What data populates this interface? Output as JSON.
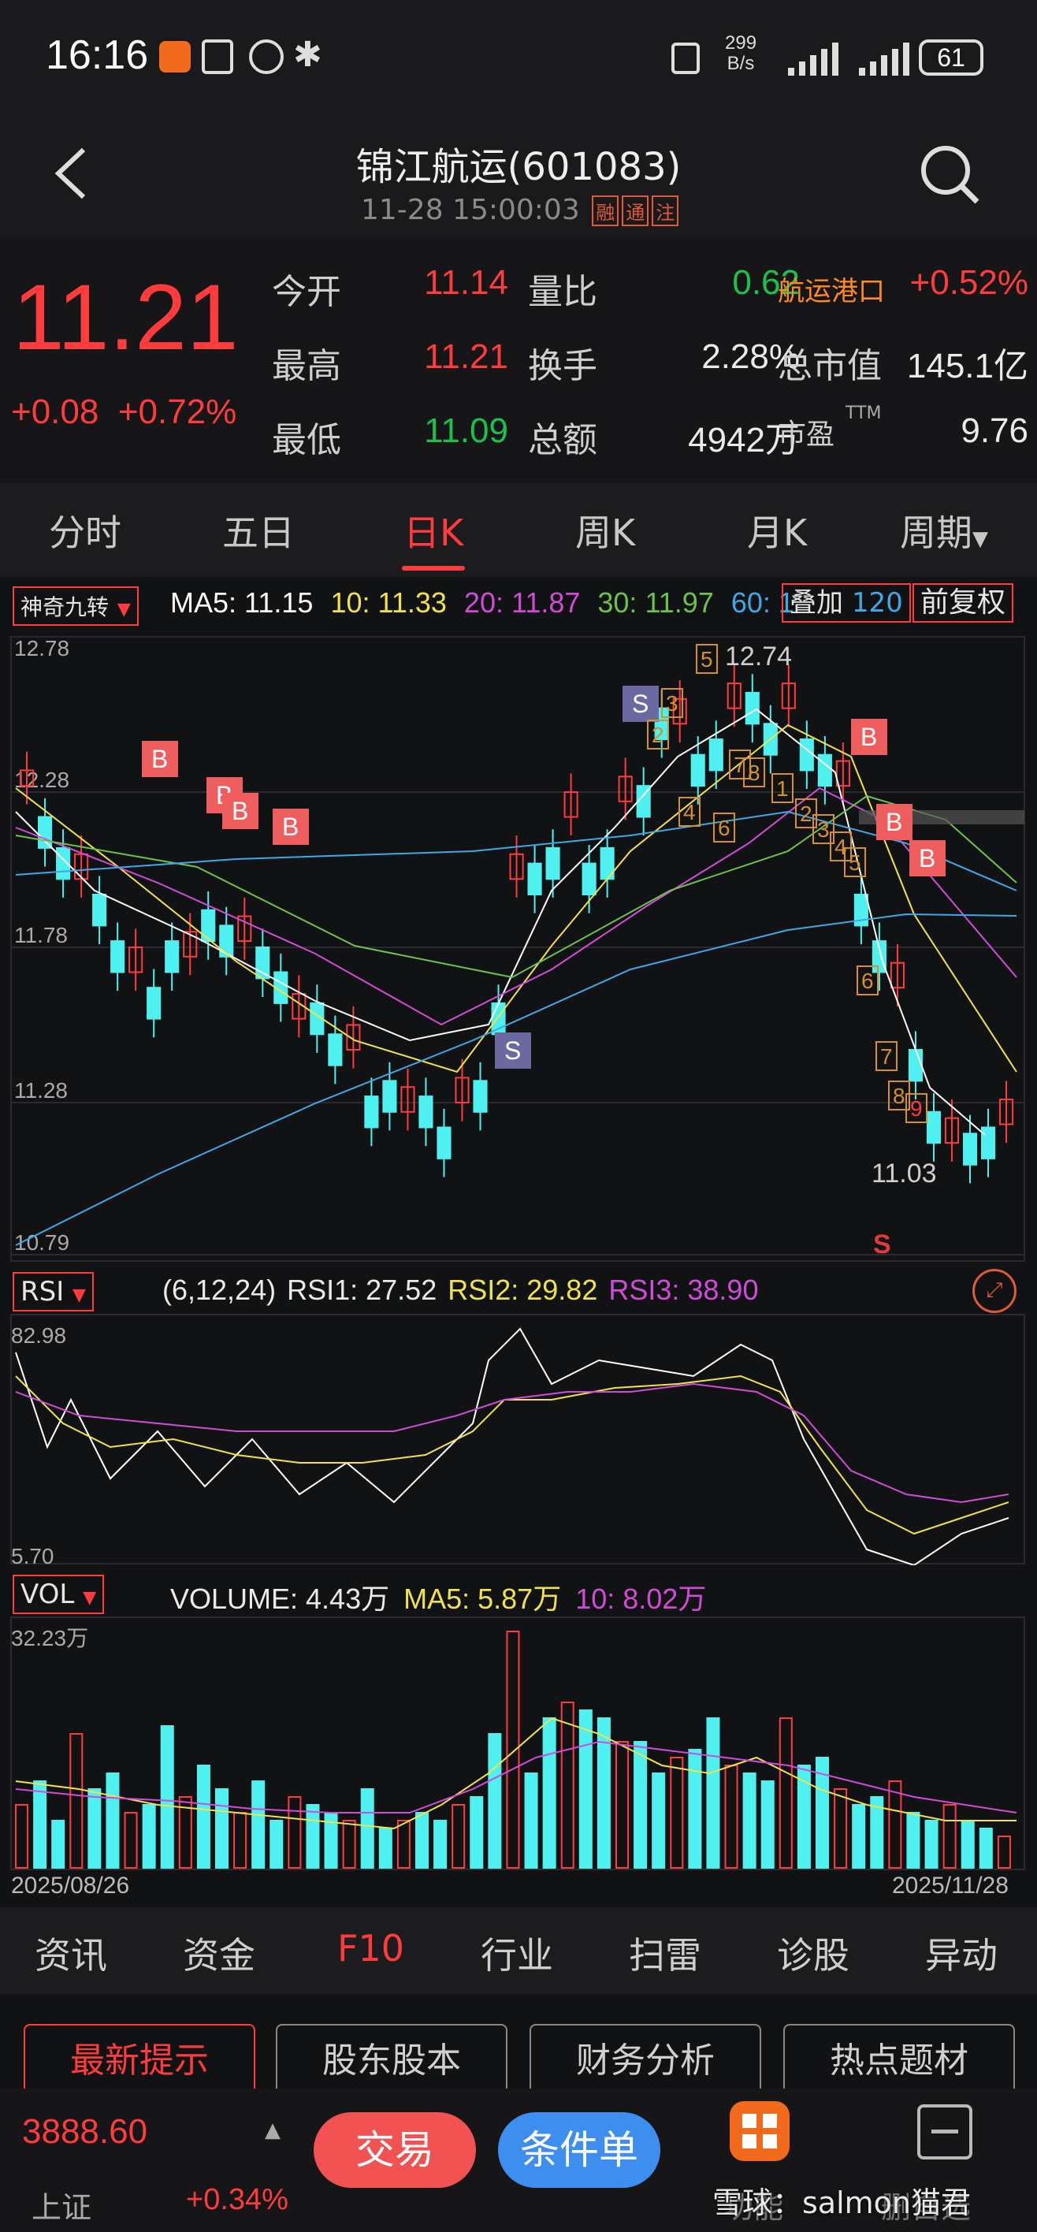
{
  "status_bar": {
    "time": "16:16",
    "net_speed_value": "299",
    "net_speed_unit": "B/s",
    "battery": "61",
    "icons": [
      "app-notification-icon",
      "nfc-icon",
      "alarm-icon",
      "bluetooth-icon",
      "vibrate-icon",
      "signal-icon",
      "signal-icon",
      "battery-icon"
    ]
  },
  "header": {
    "title": "锦江航运(601083)",
    "datetime": "11-28 15:00:03",
    "tags": [
      "融",
      "通",
      "注"
    ]
  },
  "quote": {
    "price": "11.21",
    "change_abs": "+0.08",
    "change_pct": "+0.72%",
    "rows": [
      {
        "l1": "今开",
        "v1": "11.14",
        "c1": "red",
        "l2": "量比",
        "v2": "0.62",
        "c2": "green",
        "l3": "航运港口",
        "v3": "+0.52%",
        "c3": "red"
      },
      {
        "l1": "最高",
        "v1": "11.21",
        "c1": "red",
        "l2": "换手",
        "v2": "2.28%",
        "c2": "white",
        "l3": "总市值",
        "v3": "145.1亿",
        "c3": "white"
      },
      {
        "l1": "最低",
        "v1": "11.09",
        "c1": "green",
        "l2": "总额",
        "v2": "4942万",
        "c2": "white",
        "l3": "市盈",
        "v3": "9.76",
        "c3": "white"
      }
    ],
    "pe_sup": "TTM"
  },
  "period_tabs": [
    "分时",
    "五日",
    "日K",
    "周K",
    "月K",
    "周期"
  ],
  "kline": {
    "indicator_select": "神奇九转",
    "ma_legend": [
      {
        "label": "MA5: 11.15",
        "color": "#ffffff"
      },
      {
        "label": "10: 11.33",
        "color": "#f1e24b"
      },
      {
        "label": "20: 11.87",
        "color": "#d24bd8"
      },
      {
        "label": "30: 11.97",
        "color": "#6cc24a"
      },
      {
        "label": "60: 1",
        "color": "#3fa8e6"
      }
    ],
    "overlay_btn": "叠加",
    "hidden_ma": "120",
    "adjust_btn": "前复权",
    "y_labels": [
      "12.78",
      "12.28",
      "11.78",
      "11.28",
      "10.79"
    ],
    "max_label": "12.74",
    "min_label": "11.03",
    "s_marker": "S",
    "signals": [
      {
        "text": "B",
        "kind": "B"
      },
      {
        "text": "B",
        "kind": "B"
      },
      {
        "text": "B",
        "kind": "B"
      },
      {
        "text": "B",
        "kind": "B"
      },
      {
        "text": "S",
        "kind": "S"
      },
      {
        "text": "S",
        "kind": "S"
      },
      {
        "text": "B",
        "kind": "B"
      },
      {
        "text": "B",
        "kind": "B"
      },
      {
        "text": "B",
        "kind": "B"
      }
    ],
    "nine_counts_up": [
      "2",
      "3",
      "5",
      "4",
      "6",
      "7",
      "8",
      "1",
      "2",
      "3",
      "4",
      "5"
    ],
    "nine_counts_down": [
      "6",
      "7",
      "8",
      "9"
    ]
  },
  "rsi": {
    "select": "RSI",
    "params": "(6,12,24)",
    "rsi1": "RSI1: 27.52",
    "rsi2": "RSI2: 29.82",
    "rsi3": "RSI3: 38.90",
    "y_top": "82.98",
    "y_bottom": "5.70"
  },
  "vol": {
    "select": "VOL",
    "volume": "VOLUME: 4.43万",
    "ma5": "MA5: 5.87万",
    "ma10": "10: 8.02万",
    "y_top": "32.23万",
    "date_start": "2025/08/26",
    "date_end": "2025/11/28"
  },
  "f10_tabs": [
    "资讯",
    "资金",
    "F10",
    "行业",
    "扫雷",
    "诊股",
    "异动"
  ],
  "f10_buttons": [
    "最新提示",
    "股东股本",
    "财务分析",
    "热点题材"
  ],
  "bottom": {
    "index_value": "3888.60",
    "index_name": "上证",
    "index_change": "+0.34%",
    "trade_btn": "交易",
    "cond_btn": "条件单",
    "func_label": "功能",
    "delete_label": "删自选",
    "watermark": "雪球：salmon猫君"
  },
  "colors": {
    "up": "#ff3b3b",
    "down": "#19c24a",
    "candle_down": "#4ff0f0",
    "accent": "#ff3b3b"
  }
}
